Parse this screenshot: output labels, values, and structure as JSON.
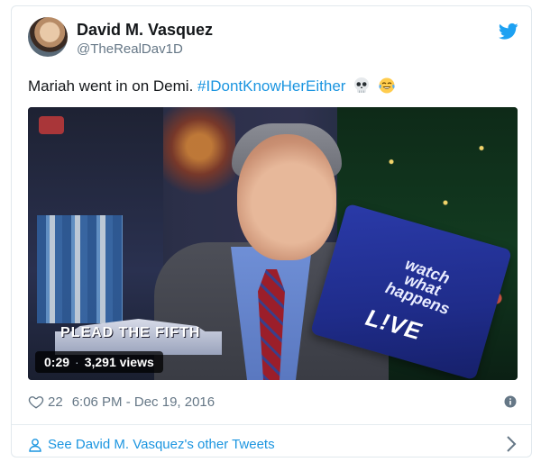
{
  "author": {
    "name": "David M. Vasquez",
    "handle": "@TheRealDav1D"
  },
  "tweet": {
    "text": "Mariah went in on Demi.",
    "hashtag": "#IDontKnowHerEither",
    "emojis": [
      "skull-emoji",
      "tears-of-joy-emoji"
    ]
  },
  "video": {
    "duration": "0:29",
    "separator": "·",
    "views": "3,291 views",
    "card_text": "watch what happens",
    "card_live": "L!VE",
    "logo_text": "PLEAD THE FIFTH"
  },
  "meta": {
    "likes": "22",
    "timestamp": "6:06 PM - Dec 19, 2016"
  },
  "footer": {
    "link": "See David M. Vasquez's other Tweets"
  },
  "colors": {
    "link": "#1b95e0",
    "muted": "#657786",
    "text": "#14171a",
    "border": "#e1e8ed"
  },
  "icons": [
    "twitter-bird-icon",
    "heart-icon",
    "info-icon",
    "person-icon",
    "chevron-right-icon"
  ]
}
